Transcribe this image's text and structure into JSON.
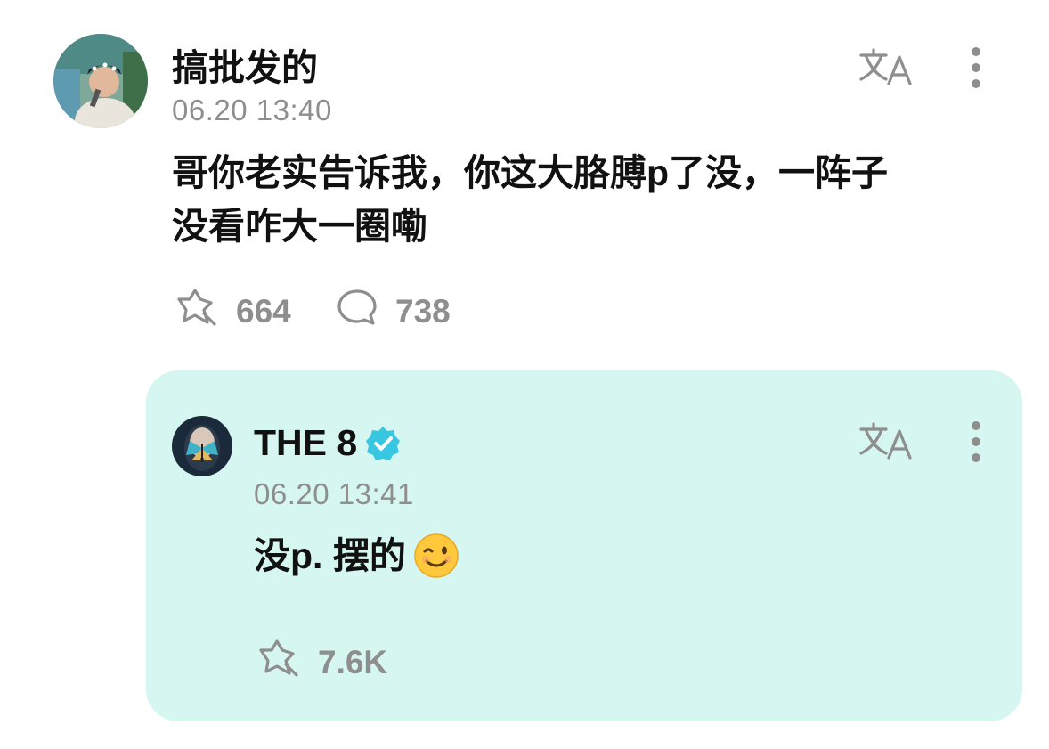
{
  "comment": {
    "username": "搞批发的",
    "timestamp": "06.20 13:40",
    "text_line1": "哥你老实告诉我，你这大胳膊p了没，一阵子",
    "text_line2": "没看咋大一圈嘞",
    "like_count": "664",
    "reply_count": "738"
  },
  "reply": {
    "username": "THE 8",
    "verified": true,
    "timestamp": "06.20 13:41",
    "text": "没p. 摆的",
    "emoji": "😉",
    "like_count": "7.6K"
  },
  "icons": {
    "translate": "translate-icon",
    "more": "more-vertical-icon",
    "like": "like-icon",
    "comment": "comment-icon",
    "verified": "verified-badge-icon"
  },
  "colors": {
    "reply_background": "#d6f6f1",
    "verified": "#37c7e0",
    "muted": "#8e8e8e"
  }
}
